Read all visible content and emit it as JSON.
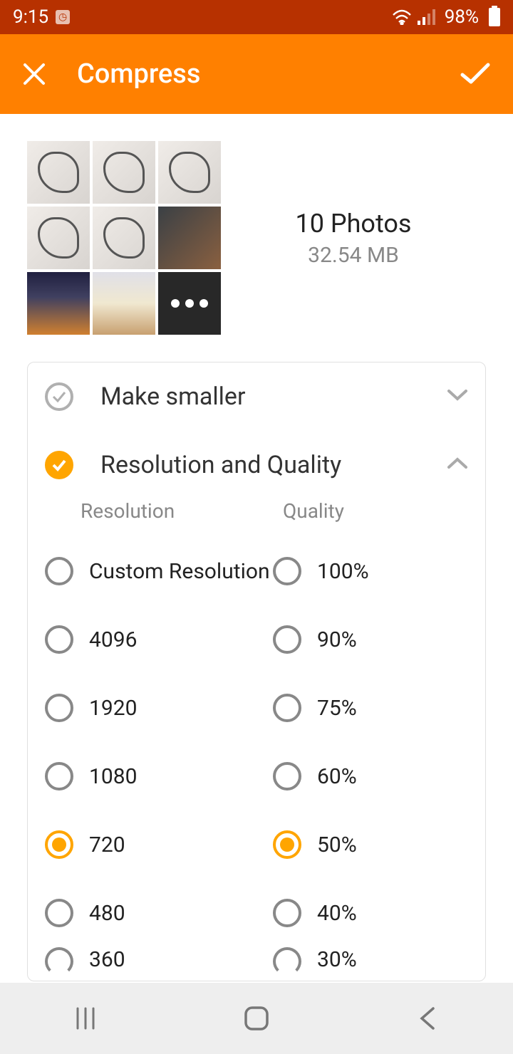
{
  "statusbar": {
    "time": "9:15",
    "battery": "98%"
  },
  "appbar": {
    "title": "Compress"
  },
  "summary": {
    "count": "10 Photos",
    "size": "32.54 MB"
  },
  "sections": {
    "make_smaller": {
      "label": "Make smaller"
    },
    "res_quality": {
      "label": "Resolution and Quality"
    }
  },
  "columns": {
    "resolution": "Resolution",
    "quality": "Quality"
  },
  "resolution_options": [
    {
      "label": "Custom Resolution",
      "selected": false
    },
    {
      "label": "4096",
      "selected": false
    },
    {
      "label": "1920",
      "selected": false
    },
    {
      "label": "1080",
      "selected": false
    },
    {
      "label": "720",
      "selected": true
    },
    {
      "label": "480",
      "selected": false
    },
    {
      "label": "360",
      "selected": false
    }
  ],
  "quality_options": [
    {
      "label": "100%",
      "selected": false
    },
    {
      "label": "90%",
      "selected": false
    },
    {
      "label": "75%",
      "selected": false
    },
    {
      "label": "60%",
      "selected": false
    },
    {
      "label": "50%",
      "selected": true
    },
    {
      "label": "40%",
      "selected": false
    },
    {
      "label": "30%",
      "selected": false
    }
  ]
}
